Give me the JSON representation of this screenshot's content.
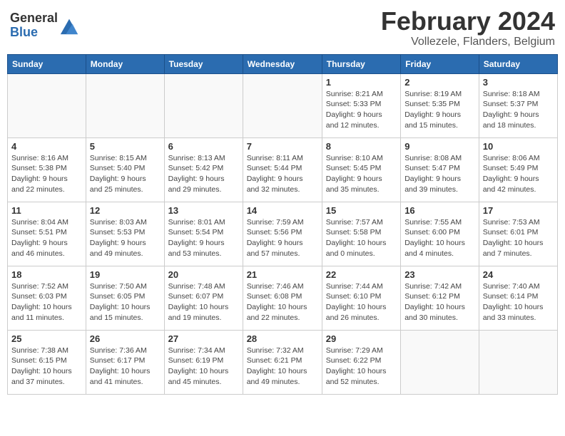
{
  "header": {
    "logo_general": "General",
    "logo_blue": "Blue",
    "month_title": "February 2024",
    "location": "Vollezele, Flanders, Belgium"
  },
  "days_of_week": [
    "Sunday",
    "Monday",
    "Tuesday",
    "Wednesday",
    "Thursday",
    "Friday",
    "Saturday"
  ],
  "weeks": [
    [
      {
        "day": "",
        "info": ""
      },
      {
        "day": "",
        "info": ""
      },
      {
        "day": "",
        "info": ""
      },
      {
        "day": "",
        "info": ""
      },
      {
        "day": "1",
        "info": "Sunrise: 8:21 AM\nSunset: 5:33 PM\nDaylight: 9 hours\nand 12 minutes."
      },
      {
        "day": "2",
        "info": "Sunrise: 8:19 AM\nSunset: 5:35 PM\nDaylight: 9 hours\nand 15 minutes."
      },
      {
        "day": "3",
        "info": "Sunrise: 8:18 AM\nSunset: 5:37 PM\nDaylight: 9 hours\nand 18 minutes."
      }
    ],
    [
      {
        "day": "4",
        "info": "Sunrise: 8:16 AM\nSunset: 5:38 PM\nDaylight: 9 hours\nand 22 minutes."
      },
      {
        "day": "5",
        "info": "Sunrise: 8:15 AM\nSunset: 5:40 PM\nDaylight: 9 hours\nand 25 minutes."
      },
      {
        "day": "6",
        "info": "Sunrise: 8:13 AM\nSunset: 5:42 PM\nDaylight: 9 hours\nand 29 minutes."
      },
      {
        "day": "7",
        "info": "Sunrise: 8:11 AM\nSunset: 5:44 PM\nDaylight: 9 hours\nand 32 minutes."
      },
      {
        "day": "8",
        "info": "Sunrise: 8:10 AM\nSunset: 5:45 PM\nDaylight: 9 hours\nand 35 minutes."
      },
      {
        "day": "9",
        "info": "Sunrise: 8:08 AM\nSunset: 5:47 PM\nDaylight: 9 hours\nand 39 minutes."
      },
      {
        "day": "10",
        "info": "Sunrise: 8:06 AM\nSunset: 5:49 PM\nDaylight: 9 hours\nand 42 minutes."
      }
    ],
    [
      {
        "day": "11",
        "info": "Sunrise: 8:04 AM\nSunset: 5:51 PM\nDaylight: 9 hours\nand 46 minutes."
      },
      {
        "day": "12",
        "info": "Sunrise: 8:03 AM\nSunset: 5:53 PM\nDaylight: 9 hours\nand 49 minutes."
      },
      {
        "day": "13",
        "info": "Sunrise: 8:01 AM\nSunset: 5:54 PM\nDaylight: 9 hours\nand 53 minutes."
      },
      {
        "day": "14",
        "info": "Sunrise: 7:59 AM\nSunset: 5:56 PM\nDaylight: 9 hours\nand 57 minutes."
      },
      {
        "day": "15",
        "info": "Sunrise: 7:57 AM\nSunset: 5:58 PM\nDaylight: 10 hours\nand 0 minutes."
      },
      {
        "day": "16",
        "info": "Sunrise: 7:55 AM\nSunset: 6:00 PM\nDaylight: 10 hours\nand 4 minutes."
      },
      {
        "day": "17",
        "info": "Sunrise: 7:53 AM\nSunset: 6:01 PM\nDaylight: 10 hours\nand 7 minutes."
      }
    ],
    [
      {
        "day": "18",
        "info": "Sunrise: 7:52 AM\nSunset: 6:03 PM\nDaylight: 10 hours\nand 11 minutes."
      },
      {
        "day": "19",
        "info": "Sunrise: 7:50 AM\nSunset: 6:05 PM\nDaylight: 10 hours\nand 15 minutes."
      },
      {
        "day": "20",
        "info": "Sunrise: 7:48 AM\nSunset: 6:07 PM\nDaylight: 10 hours\nand 19 minutes."
      },
      {
        "day": "21",
        "info": "Sunrise: 7:46 AM\nSunset: 6:08 PM\nDaylight: 10 hours\nand 22 minutes."
      },
      {
        "day": "22",
        "info": "Sunrise: 7:44 AM\nSunset: 6:10 PM\nDaylight: 10 hours\nand 26 minutes."
      },
      {
        "day": "23",
        "info": "Sunrise: 7:42 AM\nSunset: 6:12 PM\nDaylight: 10 hours\nand 30 minutes."
      },
      {
        "day": "24",
        "info": "Sunrise: 7:40 AM\nSunset: 6:14 PM\nDaylight: 10 hours\nand 33 minutes."
      }
    ],
    [
      {
        "day": "25",
        "info": "Sunrise: 7:38 AM\nSunset: 6:15 PM\nDaylight: 10 hours\nand 37 minutes."
      },
      {
        "day": "26",
        "info": "Sunrise: 7:36 AM\nSunset: 6:17 PM\nDaylight: 10 hours\nand 41 minutes."
      },
      {
        "day": "27",
        "info": "Sunrise: 7:34 AM\nSunset: 6:19 PM\nDaylight: 10 hours\nand 45 minutes."
      },
      {
        "day": "28",
        "info": "Sunrise: 7:32 AM\nSunset: 6:21 PM\nDaylight: 10 hours\nand 49 minutes."
      },
      {
        "day": "29",
        "info": "Sunrise: 7:29 AM\nSunset: 6:22 PM\nDaylight: 10 hours\nand 52 minutes."
      },
      {
        "day": "",
        "info": ""
      },
      {
        "day": "",
        "info": ""
      }
    ]
  ]
}
